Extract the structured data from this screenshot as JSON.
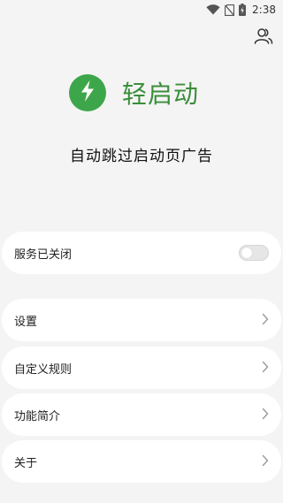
{
  "status_bar": {
    "time": "2:38",
    "icons": [
      "wifi-icon",
      "no-sim-icon",
      "battery-charging-icon"
    ]
  },
  "header": {
    "users_icon": "users-icon"
  },
  "brand": {
    "name": "轻启动",
    "logo_icon": "lightning-icon",
    "color": "#3b8e3a",
    "logo_color": "#3ea64a"
  },
  "tagline": "自动跳过启动页广告",
  "service": {
    "label": "服务已关闭",
    "enabled": false
  },
  "menu": {
    "items": [
      {
        "label": "设置"
      },
      {
        "label": "自定义规则"
      },
      {
        "label": "功能简介"
      },
      {
        "label": "关于"
      }
    ],
    "chevron_icon": "chevron-right-icon"
  }
}
